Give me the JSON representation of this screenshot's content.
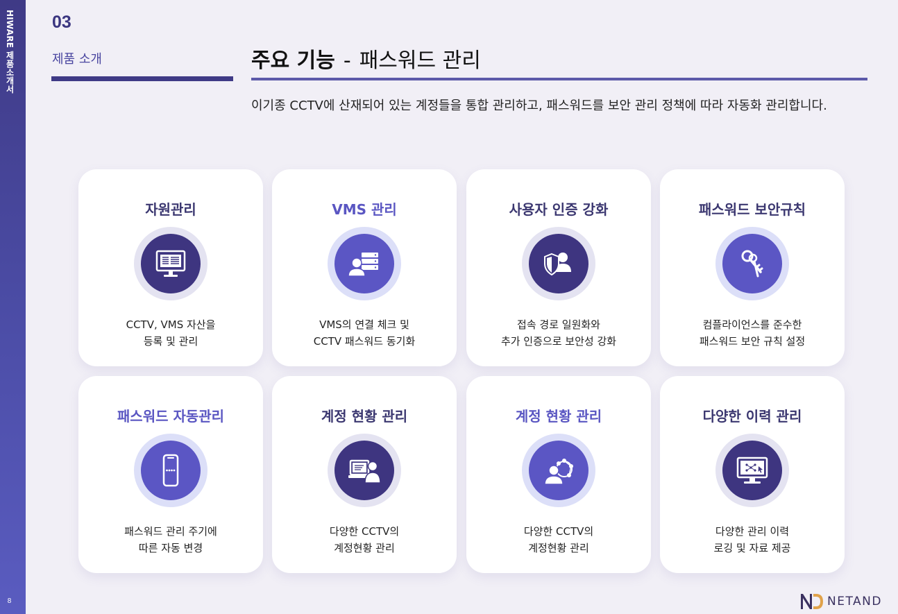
{
  "sidebar": {
    "title": "HIWARE 제품소개서",
    "page_number": "8"
  },
  "header": {
    "section_number": "03",
    "section_label": "제품 소개",
    "title_bold": "주요 기능",
    "title_dash": "-",
    "title_rest": "패스워드 관리",
    "description": "이기종 CCTV에 산재되어 있는 계정들을 통합 관리하고, 패스워드를 보안 관리 정책에 따라 자동화 관리합니다."
  },
  "cards": [
    {
      "title": "자원관리",
      "icon": "monitor-icon",
      "desc": [
        "CCTV, VMS 자산을",
        "등록 및 관리"
      ],
      "accent": false
    },
    {
      "title": "VMS 관리",
      "icon": "user-server-icon",
      "desc": [
        "VMS의 연결 체크 및",
        "CCTV 패스워드 동기화"
      ],
      "accent": true
    },
    {
      "title": "사용자 인증 강화",
      "icon": "shield-user-icon",
      "desc": [
        "접속 경로 일원화와",
        "추가 인증으로 보안성 강화"
      ],
      "accent": false
    },
    {
      "title": "패스워드 보안규칙",
      "icon": "keys-icon",
      "desc": [
        "컴플라이언스를 준수한",
        "패스워드 보안 규칙 설정"
      ],
      "accent": false
    },
    {
      "title": "패스워드 자동관리",
      "icon": "smartphone-password-icon",
      "desc": [
        "패스워드 관리 주기에",
        "따른 자동 변경"
      ],
      "accent": true
    },
    {
      "title": "계정 현황 관리",
      "icon": "laptop-user-icon",
      "desc": [
        "다양한 CCTV의",
        "계정현황 관리"
      ],
      "accent": false
    },
    {
      "title": "계정 현황 관리",
      "icon": "user-network-icon",
      "desc": [
        "다양한 CCTV의",
        "계정현황 관리"
      ],
      "accent": true
    },
    {
      "title": "다양한 이력 관리",
      "icon": "monitor-network-icon",
      "desc": [
        "다양한 관리 이력",
        "로깅 및 자료 제공"
      ],
      "accent": false
    }
  ],
  "logo": {
    "text": "NETAND",
    "mark_letters": "ND"
  },
  "colors": {
    "primary": "#3e3580",
    "accent": "#5b56c4",
    "background": "#f1eff6"
  }
}
